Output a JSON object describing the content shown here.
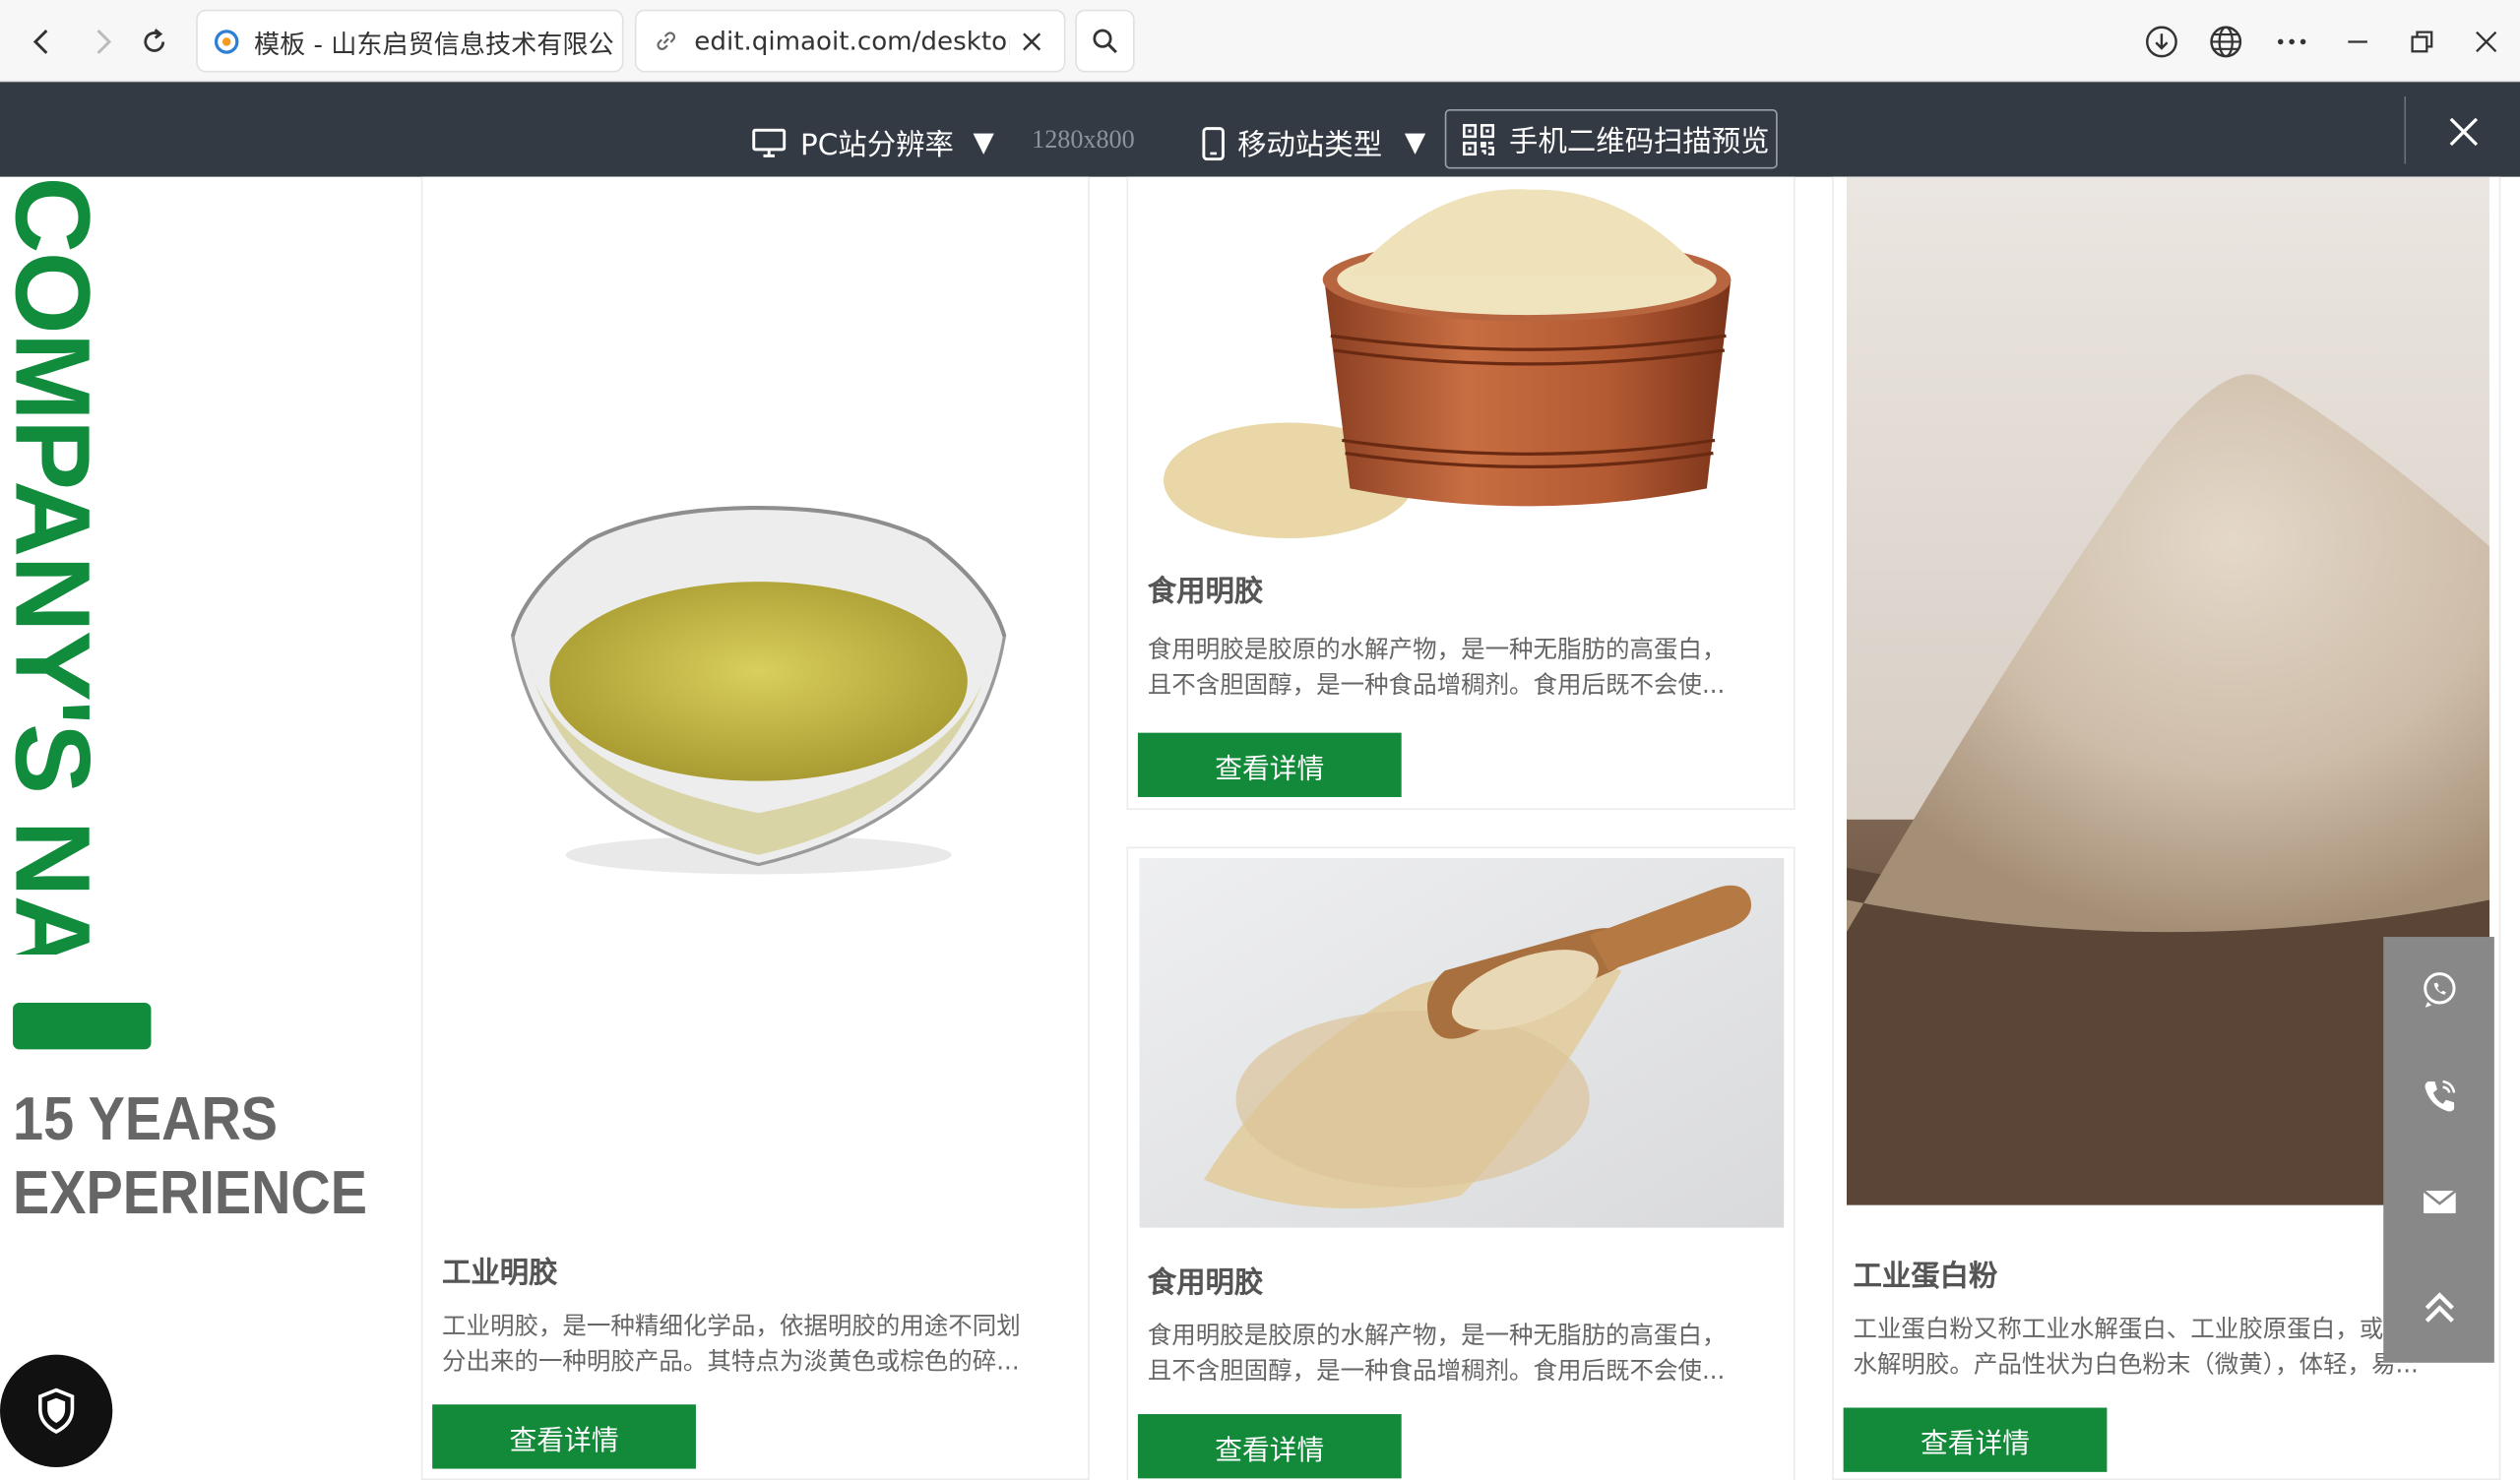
{
  "browser": {
    "tabs": [
      {
        "label": "模板 - 山东启贸信息技术有限公司"
      },
      {
        "label": "edit.qimaoit.com/desktop/h"
      }
    ],
    "icons": [
      "back-icon",
      "forward-icon",
      "reload-icon",
      "search-icon",
      "download-icon",
      "globe-icon",
      "more-icon",
      "minimize-icon",
      "restore-icon",
      "close-icon"
    ]
  },
  "toolbar": {
    "pc_resolution_label": "PC站分辨率",
    "resolution_value": "1280x800",
    "mobile_type_label": "移动站类型",
    "qr_preview_label": "手机二维码扫描预览",
    "colors": {
      "background": "#333a44",
      "text": "#ffffff"
    }
  },
  "brand": {
    "company_name": "COMPANY'S NAME",
    "experience_line1": "15 YEARS",
    "experience_line2": "EXPERIENCE",
    "accent_color": "#108c3c"
  },
  "products": [
    {
      "title": "工业明胶",
      "desc_line1": "工业明胶，是一种精细化学品，依据明胶的用途不同划",
      "desc_line2": "分出来的一种明胶产品。其特点为淡黄色或棕色的碎...",
      "button": "查看详情",
      "image": "gelatin-glass-bowl"
    },
    {
      "title": "食用明胶",
      "desc_line1": "食用明胶是胶原的水解产物，是一种无脂肪的高蛋白，",
      "desc_line2": "且不含胆固醇，是一种食品增稠剂。食用后既不会使...",
      "button": "查看详情",
      "image": "gelatin-wooden-bowl"
    },
    {
      "title": "食用明胶",
      "desc_line1": "食用明胶是胶原的水解产物，是一种无脂肪的高蛋白，",
      "desc_line2": "且不含胆固醇，是一种食品增稠剂。食用后既不会使...",
      "button": "查看详情",
      "image": "gelatin-wooden-scoop"
    },
    {
      "title": "工业蛋白粉",
      "desc_line1": "工业蛋白粉又称工业水解蛋白、工业胶原蛋白，或工业",
      "desc_line2": "水解明胶。产品性状为白色粉末（微黄），体轻，易...",
      "button": "查看详情",
      "image": "protein-powder-bowl"
    }
  ],
  "float_bar": {
    "icons": [
      "whatsapp-icon",
      "phone-icon",
      "mail-icon",
      "back-to-top-icon"
    ],
    "color": "#888888"
  },
  "shield_button": {
    "icon": "shield-icon"
  }
}
